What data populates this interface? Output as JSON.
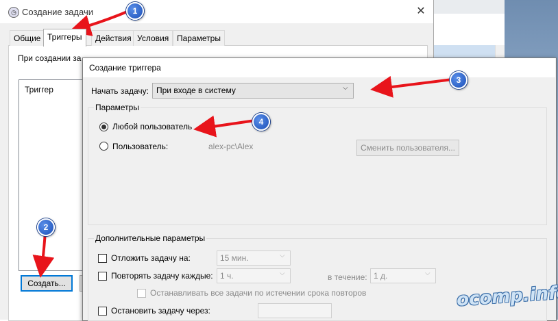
{
  "main_dialog": {
    "title": "Создание задачи",
    "close_glyph": "✕",
    "tabs": [
      {
        "label": "Общие"
      },
      {
        "label": "Триггеры"
      },
      {
        "label": "Действия"
      },
      {
        "label": "Условия"
      },
      {
        "label": "Параметры"
      }
    ],
    "panel_description": "При создании за",
    "trigger_column": "Триггер",
    "create_button": "Создать..."
  },
  "trigger_dialog": {
    "title": "Создание триггера",
    "start_label": "Начать задачу:",
    "start_value": "При входе в систему",
    "params_legend": "Параметры",
    "any_user_label": "Любой пользователь",
    "user_label": "Пользователь:",
    "user_value": "alex-pc\\Alex",
    "change_user_button": "Сменить пользователя...",
    "advanced_legend": "Дополнительные параметры",
    "delay_label": "Отложить задачу на:",
    "delay_value": "15 мин.",
    "repeat_label": "Повторять задачу каждые:",
    "repeat_value": "1 ч.",
    "during_label": "в течение:",
    "during_value": "1 д.",
    "stop_all_label": "Останавливать все задачи по истечении срока повторов",
    "stop_label": "Остановить задачу через:"
  },
  "annotations": {
    "badges": [
      "1",
      "2",
      "3",
      "4"
    ],
    "watermark": "ocomp.info",
    "arrow_color": "#e8141b"
  },
  "colors": {
    "accent": "#0078d7",
    "dialog_bg": "#f0f0f0"
  }
}
